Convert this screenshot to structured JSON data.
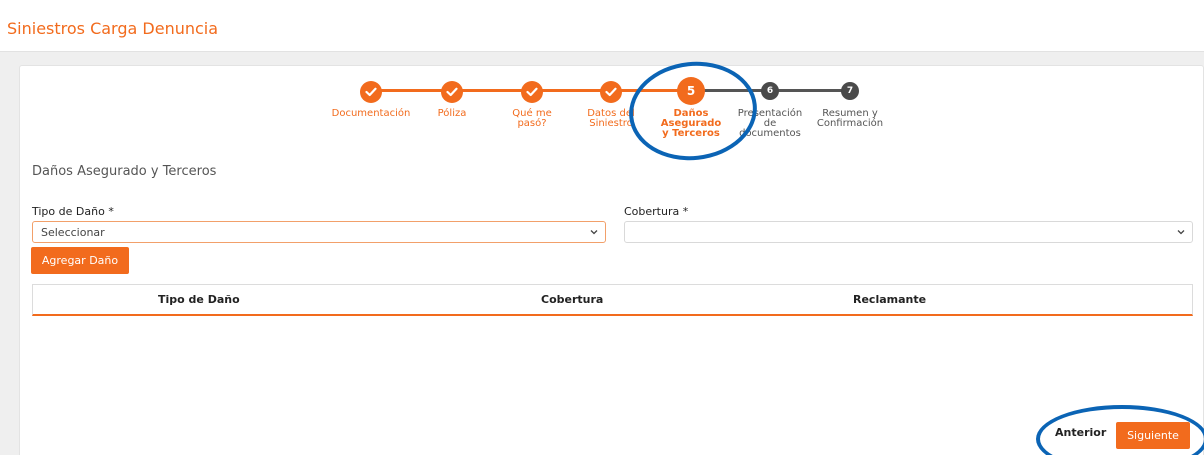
{
  "app": {
    "title": "Siniestros Carga Denuncia"
  },
  "colors": {
    "accent": "#f26b1d",
    "step_pending": "#4a4a4a",
    "annotation": "#0b64b5"
  },
  "stepper": {
    "current_step": 5,
    "steps": [
      {
        "number": "1",
        "label": "Documentación",
        "status": "done",
        "icon": "check-icon"
      },
      {
        "number": "2",
        "label": "Póliza",
        "status": "done",
        "icon": "check-icon"
      },
      {
        "number": "3",
        "label": "Qué me pasó?",
        "status": "done",
        "icon": "check-icon"
      },
      {
        "number": "4",
        "label": "Datos del Siniestro",
        "status": "done",
        "icon": "check-icon"
      },
      {
        "number": "5",
        "label": "Daños Asegurado y Terceros",
        "status": "current"
      },
      {
        "number": "6",
        "label": "Presentación de documentos",
        "status": "pending"
      },
      {
        "number": "7",
        "label": "Resumen y Confirmación",
        "status": "pending"
      }
    ]
  },
  "section": {
    "title": "Daños Asegurado y Terceros"
  },
  "form": {
    "tipo_dano": {
      "label": "Tipo de Daño",
      "required_mark": "*",
      "value": "Seleccionar"
    },
    "cobertura": {
      "label": "Cobertura",
      "required_mark": "*",
      "value": ""
    },
    "add_button": "Agregar Daño"
  },
  "table": {
    "columns": [
      "Tipo de Daño",
      "Cobertura",
      "Reclamante"
    ],
    "rows": []
  },
  "footer": {
    "previous_label": "Anterior",
    "next_label": "Siguiente"
  }
}
